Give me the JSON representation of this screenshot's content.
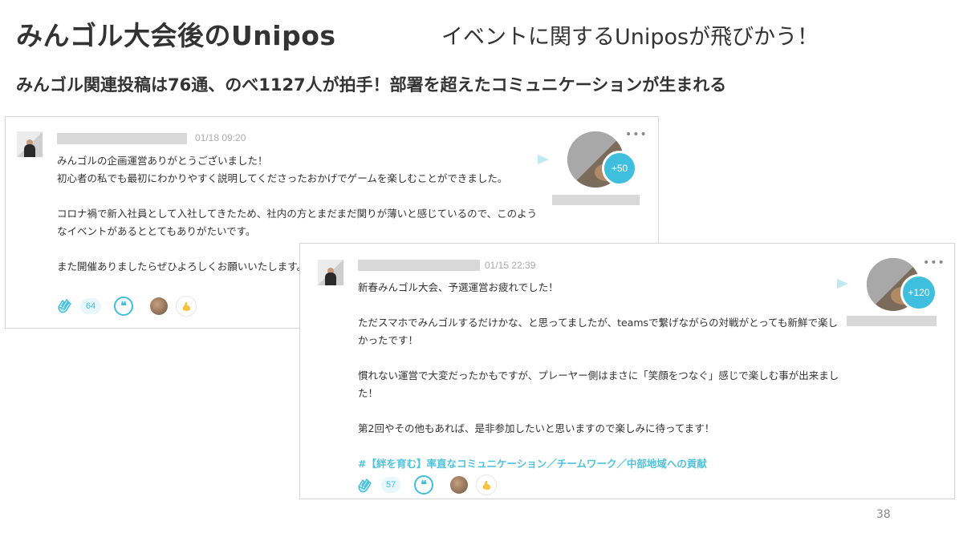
{
  "slide": {
    "title": "みんゴル大会後のUnipos",
    "subtitle": "イベントに関するUniposが飛びかう！",
    "lead": "みんゴル関連投稿は76通、のべ1127人が拍手！部署を超えたコミュニケーションが生まれる",
    "page_number": "38"
  },
  "posts": [
    {
      "timestamp": "01/18 09:20",
      "body": [
        "みんゴルの企画運営ありがとうございました！",
        "初心者の私でも最初にわかりやすく説明してくださったおかげでゲームを楽しむことができました。",
        "",
        "コロナ禍で新入社員として入社してきたため、社内の方とまだまだ関りが薄いと感じているので、このよう",
        "なイベントがあるととてもありがたいです。",
        "",
        "また開催ありましたらぜひよろしくお願いいたします。"
      ],
      "clap_badge": "+50",
      "clap_count": "64"
    },
    {
      "timestamp": "01/15 22:39",
      "body": [
        "新春みんゴル大会、予選運営お疲れでした！",
        "",
        "ただスマホでみんゴルするだけかな、と思ってましたが、teamsで繋げながらの対戦がとっても新鮮で楽し",
        "かったです！",
        "",
        "慣れない運営で大変だったかもですが、プレーヤー側はまさに「笑顔をつなぐ」感じで楽しむ事が出来まし",
        "た！",
        "",
        "第2回やその他もあれば、是非参加したいと思いますので楽しみに待ってます！",
        ""
      ],
      "hashtag": "#【絆を育む】率直なコミュニケーション／チームワーク／中部地域への貢献",
      "clap_badge": "+120",
      "clap_count": "57"
    }
  ],
  "icons": {
    "send": "send-icon",
    "more": "more-options-icon",
    "clap": "clap-hands-icon",
    "comment": "quote-comment-icon",
    "emoji": "flexed-arm-emoji-icon"
  },
  "colors": {
    "accent": "#3fbfdd",
    "hashtag": "#4fc3dc",
    "placeholder": "#d8d8d8"
  }
}
